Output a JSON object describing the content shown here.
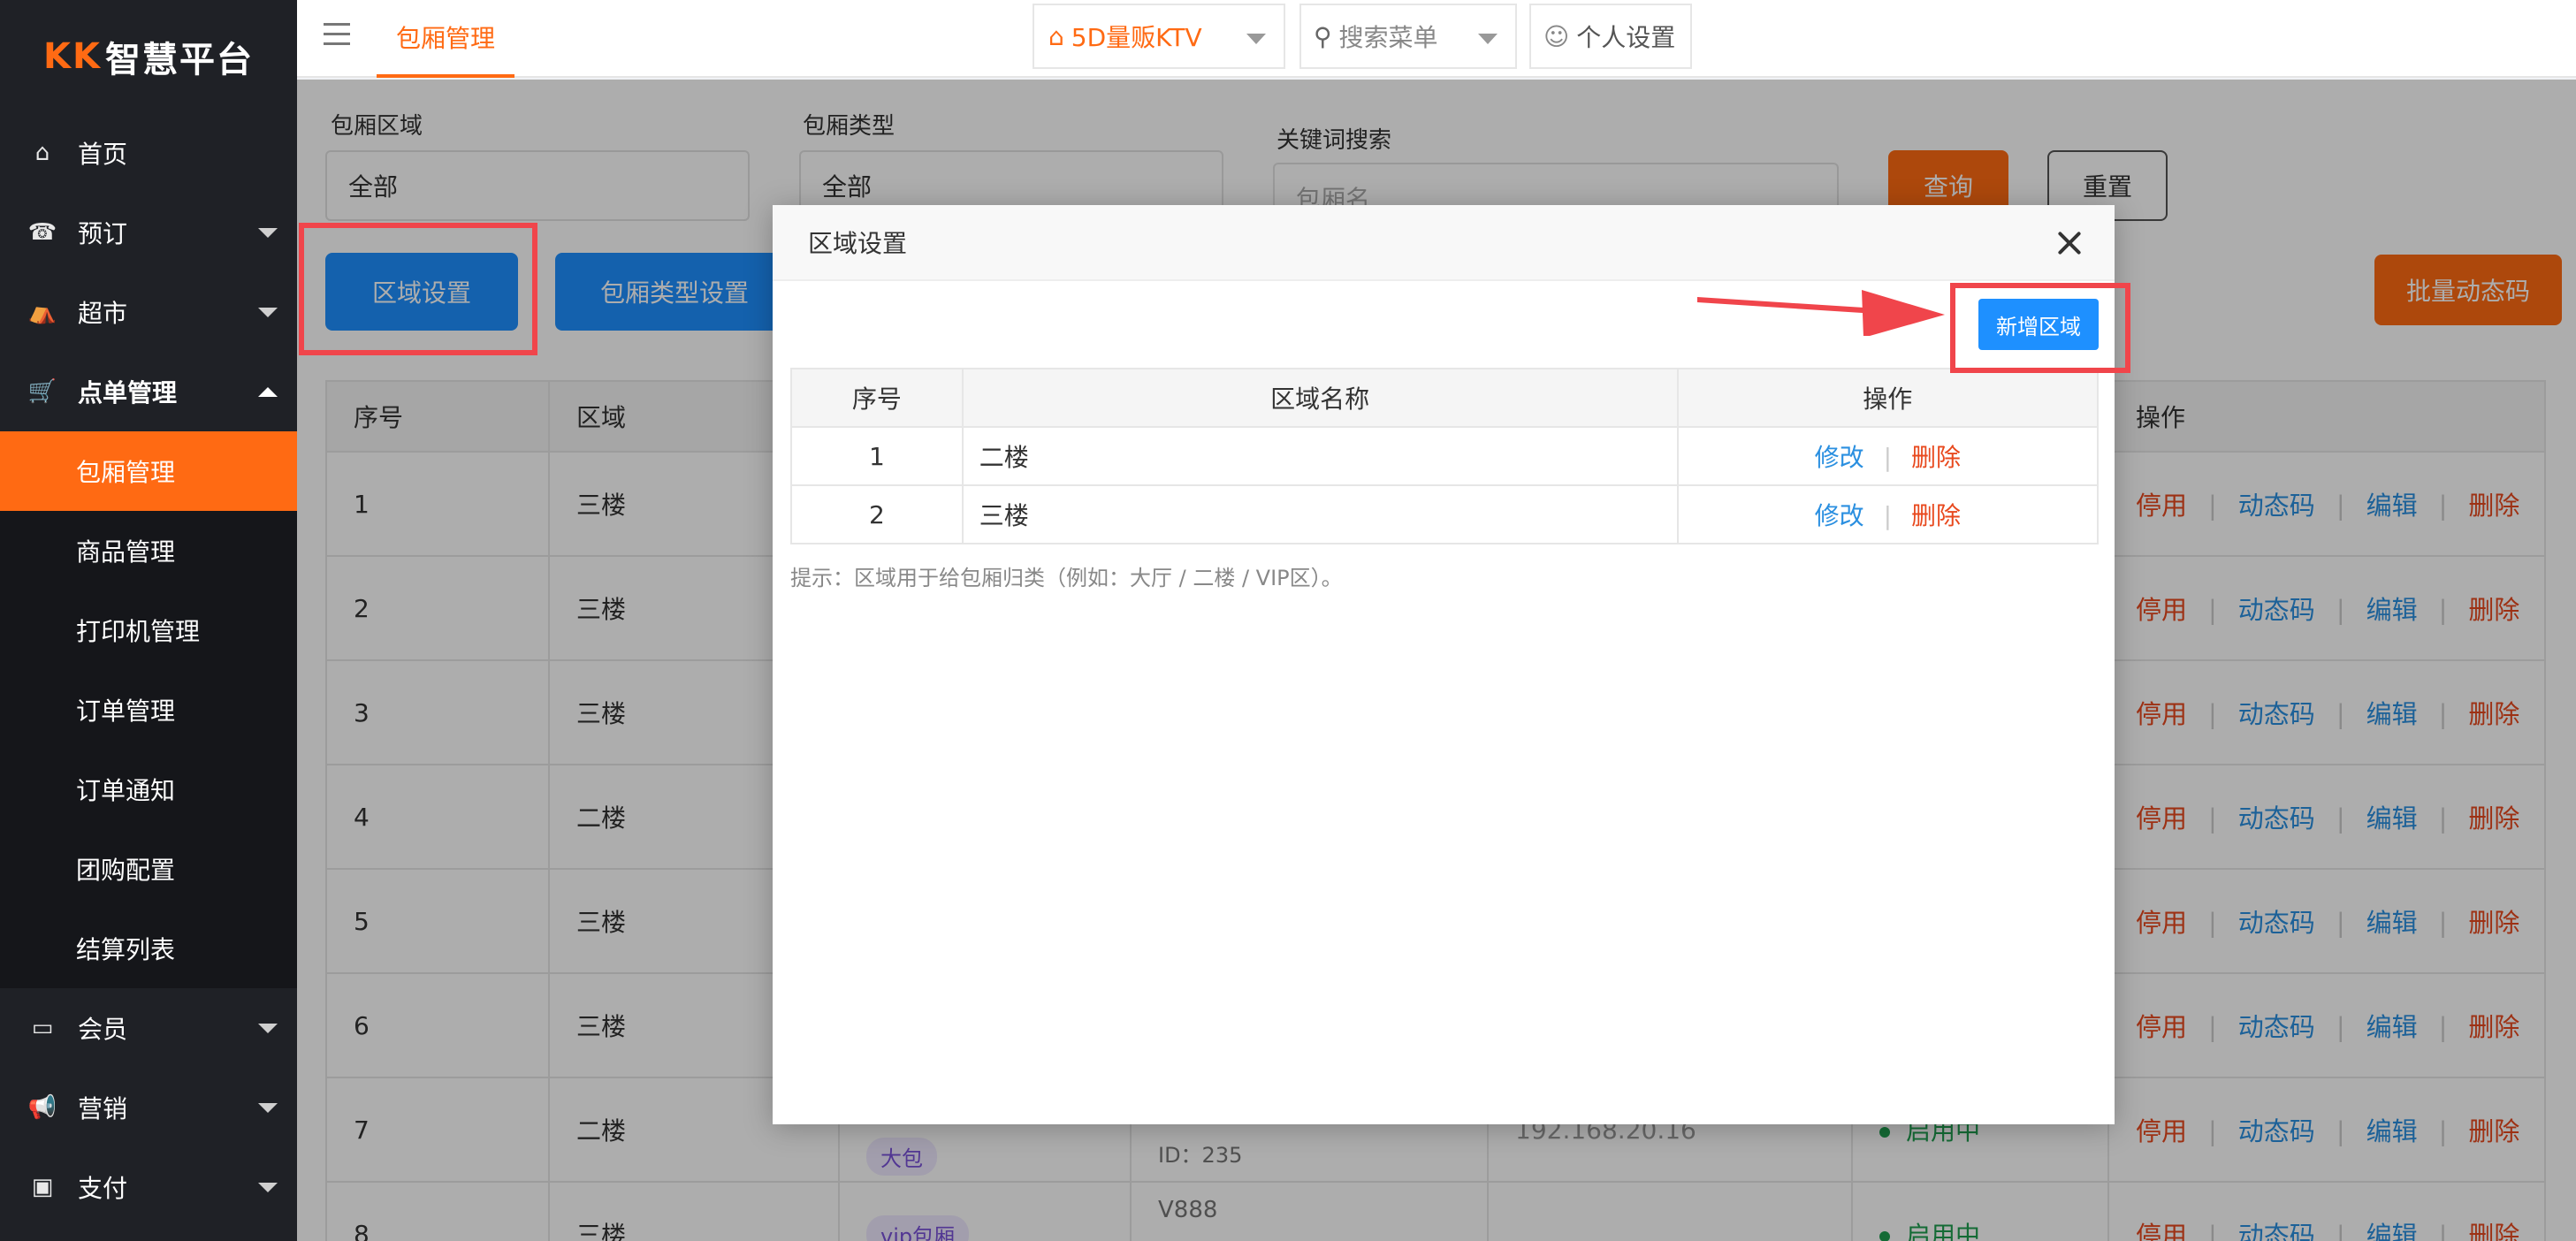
{
  "brand": {
    "logo": "KK",
    "name": "智慧平台"
  },
  "sidebar": {
    "items": [
      {
        "label": "首页",
        "icon": "home-icon",
        "glyph": "⌂"
      },
      {
        "label": "预订",
        "icon": "phone-icon",
        "glyph": "☎"
      },
      {
        "label": "超市",
        "icon": "basket-icon",
        "glyph": "⛺"
      },
      {
        "label": "点单管理",
        "icon": "cart-icon",
        "glyph": "🛒"
      }
    ],
    "sub_items": [
      "包厢管理",
      "商品管理",
      "打印机管理",
      "订单管理",
      "订单通知",
      "团购配置",
      "结算列表"
    ],
    "bottom_items": [
      {
        "label": "会员",
        "icon": "card-icon",
        "glyph": "▭"
      },
      {
        "label": "营销",
        "icon": "megaphone-icon",
        "glyph": "📢"
      },
      {
        "label": "支付",
        "icon": "money-icon",
        "glyph": "▣"
      }
    ]
  },
  "topbar": {
    "tab": "包厢管理",
    "store": "5D量贩KTV",
    "search": "搜索菜单",
    "settings": "个人设置"
  },
  "filters": {
    "area_label": "包厢区域",
    "area_value": "全部",
    "type_label": "包厢类型",
    "type_value": "全部",
    "keyword_label": "关键词搜索",
    "keyword_placeholder": "包厢名",
    "query": "查询",
    "reset": "重置",
    "area_setting": "区域设置",
    "type_setting": "包厢类型设置",
    "batch_code": "批量动态码"
  },
  "table": {
    "headers": [
      "序号",
      "区域",
      "操作"
    ],
    "rows": [
      {
        "no": "1",
        "area": "三楼"
      },
      {
        "no": "2",
        "area": "三楼"
      },
      {
        "no": "3",
        "area": "三楼"
      },
      {
        "no": "4",
        "area": "二楼"
      },
      {
        "no": "5",
        "area": "三楼"
      },
      {
        "no": "6",
        "area": "三楼"
      },
      {
        "no": "7",
        "area": "二楼",
        "badge": "大包",
        "extra": "ID：235",
        "ip": "192.168.20.16",
        "status": "启用中"
      },
      {
        "no": "8",
        "area": "三楼",
        "badge": "vip包厢",
        "extra": "V888",
        "status": "启用中"
      }
    ],
    "ops": {
      "disable": "停用",
      "code": "动态码",
      "edit": "编辑",
      "delete": "删除"
    }
  },
  "modal": {
    "title": "区域设置",
    "add_button": "新增区域",
    "headers": [
      "序号",
      "区域名称",
      "操作"
    ],
    "rows": [
      {
        "no": "1",
        "name": "二楼"
      },
      {
        "no": "2",
        "name": "三楼"
      }
    ],
    "ops": {
      "edit": "修改",
      "delete": "删除"
    },
    "hint": "提示：区域用于给包厢归类（例如：大厅 / 二楼 / VIP区）。"
  }
}
